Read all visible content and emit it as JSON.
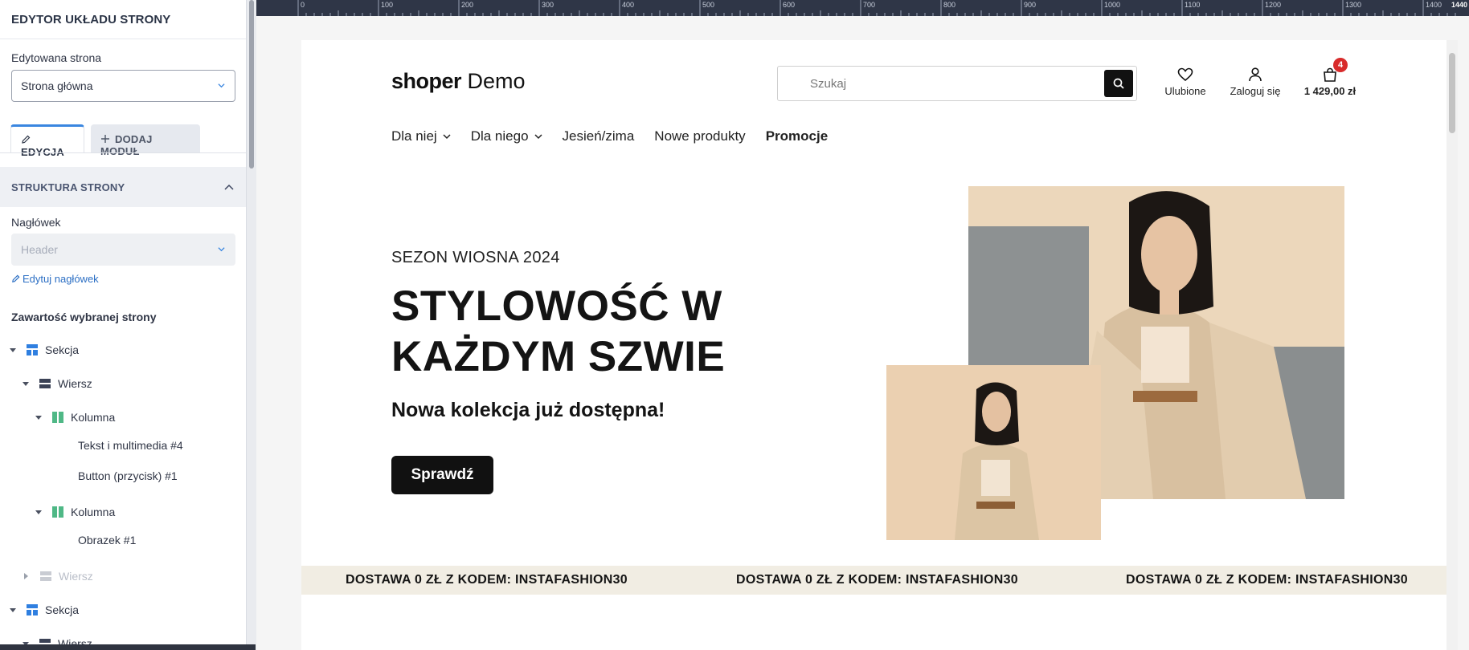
{
  "sidebar": {
    "title": "EDYTOR UKŁADU STRONY",
    "edited_page_label": "Edytowana strona",
    "edited_page_value": "Strona główna",
    "tabs": {
      "edit": "EDYCJA",
      "add_module": "DODAJ MODUŁ"
    },
    "structure_title": "STRUKTURA STRONY",
    "header_label": "Nagłówek",
    "header_value": "Header",
    "edit_header_link": "Edytuj nagłówek",
    "content_title": "Zawartość wybranej strony",
    "tree": [
      {
        "label": "Sekcja",
        "icon": "section-icon",
        "expanded": true
      },
      {
        "label": "Wiersz",
        "icon": "row-icon",
        "expanded": true
      },
      {
        "label": "Kolumna",
        "icon": "column-icon",
        "expanded": true
      },
      {
        "label": "Tekst i multimedia #4"
      },
      {
        "label": "Button (przycisk) #1"
      },
      {
        "label": "Kolumna",
        "icon": "column-icon",
        "expanded": true
      },
      {
        "label": "Obrazek #1"
      },
      {
        "label": "Wiersz",
        "icon": "row-icon",
        "expanded": false,
        "disabled": true
      },
      {
        "label": "Sekcja",
        "icon": "section-icon",
        "expanded": true
      },
      {
        "label": "Wiersz",
        "icon": "row-icon",
        "expanded": true
      }
    ]
  },
  "ruler": {
    "labels": [
      "0",
      "100",
      "200",
      "300",
      "400",
      "500",
      "600",
      "700",
      "800",
      "900",
      "1000",
      "1100",
      "1200",
      "1300",
      "1400",
      "1440"
    ]
  },
  "store": {
    "logo_bold": "shoper",
    "logo_light": "Demo",
    "search_placeholder": "Szukaj",
    "favorites_label": "Ulubione",
    "login_label": "Zaloguj się",
    "cart_total": "1 429,00 zł",
    "cart_count": "4",
    "nav": [
      "Dla niej",
      "Dla niego",
      "Jesień/zima",
      "Nowe produkty",
      "Promocje"
    ],
    "hero": {
      "season": "SEZON WIOSNA 2024",
      "headline": "STYLOWOŚĆ W KAŻDYM SZWIE",
      "subheadline": "Nowa kolekcja już dostępna!",
      "cta": "Sprawdź"
    },
    "banner": [
      "DOSTAWA 0 ZŁ Z KODEM: INSTAFASHION30",
      "DOSTAWA 0 ZŁ Z KODEM: INSTAFASHION30",
      "DOSTAWA 0 ZŁ Z KODEM: INSTAFASHION30"
    ]
  },
  "colors": {
    "accent": "#3a86e0",
    "link": "#2c6fc4",
    "ruler_bg": "#2f3647",
    "badge": "#d82b2b",
    "banner_bg": "#f1ede3"
  }
}
